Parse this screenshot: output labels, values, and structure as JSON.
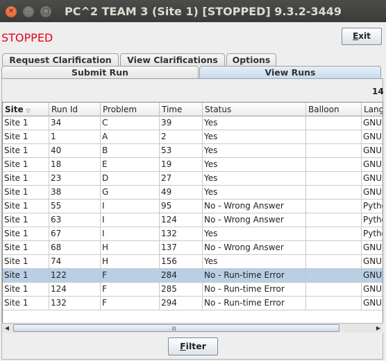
{
  "window": {
    "title": "PC^2 TEAM 3 (Site 1) [STOPPED] 9.3.2-3449",
    "close_glyph": "✕",
    "minimize_glyph": "–",
    "maximize_glyph": "□"
  },
  "status": {
    "text": "STOPPED",
    "color": "#e8001c"
  },
  "exit_button": {
    "mnemonic": "E",
    "rest": "xit"
  },
  "tabs_row1": [
    {
      "label": "Request Clarification"
    },
    {
      "label": "View Clarifications"
    },
    {
      "label": "Options"
    }
  ],
  "tabs_row2": [
    {
      "label": "Submit Run"
    },
    {
      "label": "View Runs",
      "selected": true
    }
  ],
  "run_count": "14",
  "table": {
    "columns": [
      "Site",
      "Run Id",
      "Problem",
      "Time",
      "Status",
      "Balloon",
      "Lang"
    ],
    "sort_column": "Site",
    "rows": [
      [
        "Site 1",
        "34",
        "C",
        "39",
        "Yes",
        "",
        "GNU"
      ],
      [
        "Site 1",
        "1",
        "A",
        "2",
        "Yes",
        "",
        "GNU"
      ],
      [
        "Site 1",
        "40",
        "B",
        "53",
        "Yes",
        "",
        "GNU"
      ],
      [
        "Site 1",
        "18",
        "E",
        "19",
        "Yes",
        "",
        "GNU"
      ],
      [
        "Site 1",
        "23",
        "D",
        "27",
        "Yes",
        "",
        "GNU"
      ],
      [
        "Site 1",
        "38",
        "G",
        "49",
        "Yes",
        "",
        "GNU"
      ],
      [
        "Site 1",
        "55",
        "I",
        "95",
        "No - Wrong Answer",
        "",
        "Pytho"
      ],
      [
        "Site 1",
        "63",
        "I",
        "124",
        "No - Wrong Answer",
        "",
        "Pytho"
      ],
      [
        "Site 1",
        "67",
        "I",
        "132",
        "Yes",
        "",
        "Pytho"
      ],
      [
        "Site 1",
        "68",
        "H",
        "137",
        "No - Wrong Answer",
        "",
        "GNU"
      ],
      [
        "Site 1",
        "74",
        "H",
        "156",
        "Yes",
        "",
        "GNU"
      ],
      [
        "Site 1",
        "122",
        "F",
        "284",
        "No - Run-time Error",
        "",
        "GNU"
      ],
      [
        "Site 1",
        "124",
        "F",
        "285",
        "No - Run-time Error",
        "",
        "GNU"
      ],
      [
        "Site 1",
        "132",
        "F",
        "294",
        "No - Run-time Error",
        "",
        "GNU"
      ]
    ],
    "selected_row": 11
  },
  "filter_button": {
    "mnemonic": "F",
    "rest": "ilter"
  },
  "colors": {
    "title_bar": "#3c3b37",
    "selection": "#b8cfe5",
    "tab_selected": "#c8daee"
  }
}
